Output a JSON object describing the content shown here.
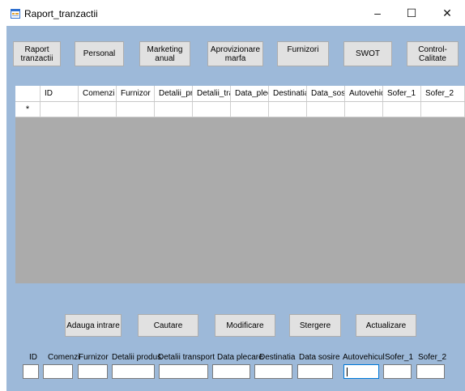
{
  "window": {
    "title": "Raport_tranzactii",
    "minimize_glyph": "–",
    "maximize_glyph": "☐",
    "close_glyph": "✕",
    "icon": "form-icon"
  },
  "nav": {
    "raport_tranzactii": "Raport\ntranzactii",
    "personal": "Personal",
    "marketing": "Marketing\nanual",
    "aprovizionare": "Aprovizionare\nmarfa",
    "furnizori": "Furnizori",
    "swot": "SWOT",
    "control_calitate": "Control-Calitate"
  },
  "grid": {
    "columns": [
      "ID",
      "Comenzi",
      "Furnizor",
      "Detalii_produ",
      "Detalii_tran",
      "Data_plecar",
      "Destinatia",
      "Data_sosire",
      "Autovehicu",
      "Sofer_1",
      "Sofer_2"
    ],
    "new_row_marker": "*"
  },
  "actions": {
    "adauga": "Adauga intrare",
    "cautare": "Cautare",
    "modificare": "Modificare",
    "stergere": "Stergere",
    "actualizare": "Actualizare"
  },
  "form": {
    "labels": [
      "ID",
      "Comenzi",
      "Furnizor",
      "Detalii produs",
      "Detalii transport",
      "Data plecare",
      "Destinatia",
      "Data sosire",
      "Autovehicul",
      "Sofer_1",
      "Sofer_2"
    ],
    "values": [
      "",
      "",
      "",
      "",
      "",
      "",
      "",
      "",
      "",
      "",
      ""
    ],
    "focused_field": "Autovehicul"
  },
  "colors": {
    "client_background": "#9db9d9",
    "grid_background": "#ababab",
    "button_face": "#e1e1e1",
    "focus_border": "#0078d7"
  }
}
